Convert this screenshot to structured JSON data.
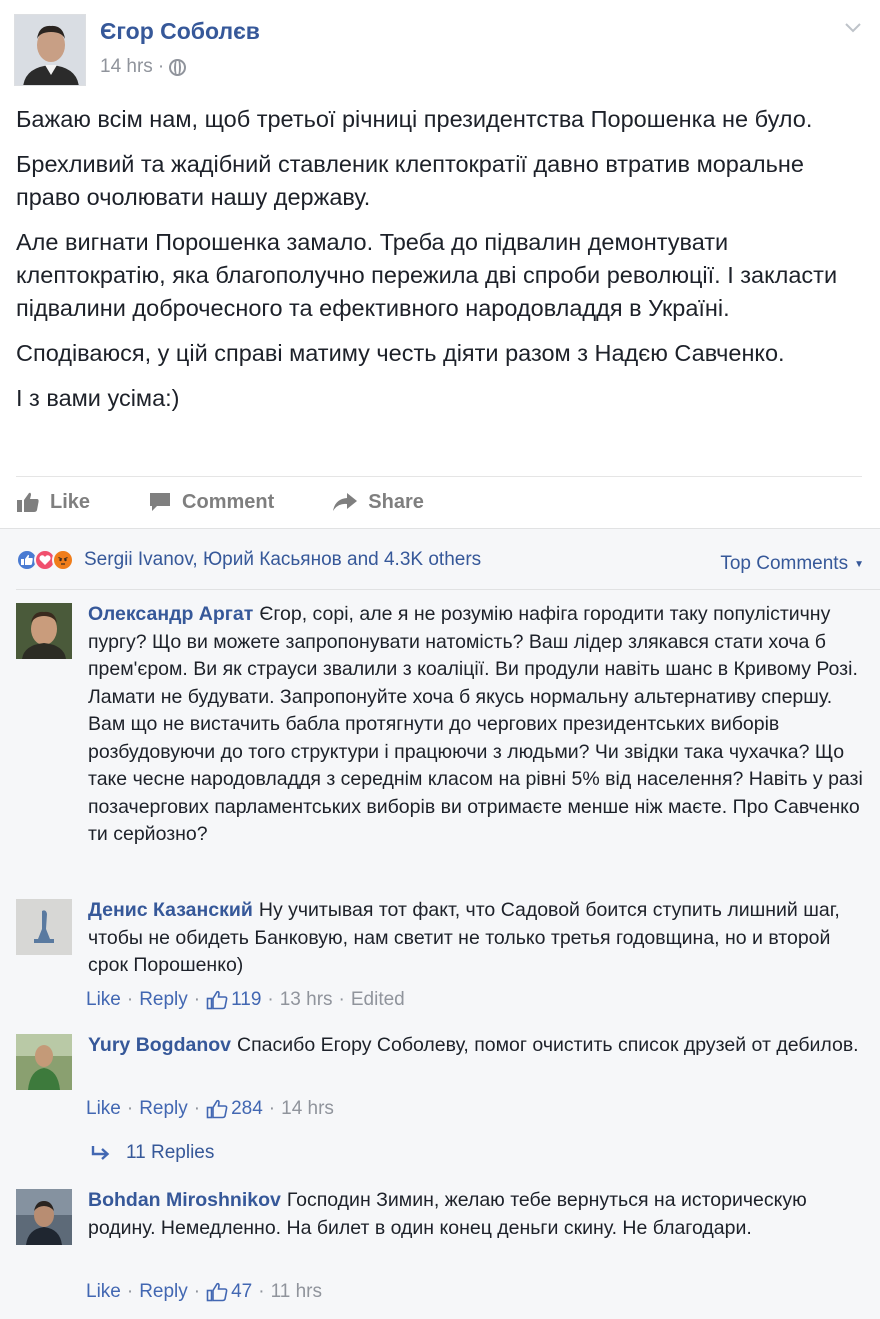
{
  "post": {
    "author": "Єгор Соболєв",
    "time": "14 hrs",
    "meta_separator": "·",
    "paragraphs": [
      "Бажаю всім нам, щоб третьої річниці президентства Порошенка не було.",
      "Брехливий та жадібний ставленик клептократії давно втратив моральне право очолювати нашу державу.",
      "Але вигнати Порошенка замало. Треба до підвалин демонтувати клептократію, яка благополучно пережила дві спроби революції. І закласти підвалини доброчесного та ефективного народовладдя в Україні.",
      "Сподіваюся, у цій справі матиму честь діяти разом з Надєю Савченко.",
      "І з вами усіма:)"
    ]
  },
  "actions": {
    "like": "Like",
    "comment": "Comment",
    "share": "Share"
  },
  "reactions": {
    "summary": "Sergii Ivanov, Юрий Касьянов and 4.3K others",
    "sort_label": "Top Comments"
  },
  "comments": [
    {
      "author": "Олександр Аргат",
      "text": "Єгор, сорі, але я не розумію нафіга городити таку популістичну пургу? Що ви можете запропонувати натомість? Ваш лідер злякався стати хоча б прем'єром. Ви як страуси звалили з коаліції. Ви продули навіть шанс в Кривому Розі. Ламати не будувати. Запропонуйте хоча б якусь нормальну альтернативу спершу. Вам що не вистачить бабла протягнути до чергових президентських виборів розбудовуючи до того структури і працюючи з людьми? Чи звідки така чухачка? Що таке чесне народовладдя з середнім класом на рівні 5% від населення? Навіть у разі позачергових парламентських виборів ви отримаєте менше ніж маєте. Про Савченко ти серйозно?"
    },
    {
      "author": "Денис Казанский",
      "text": "Ну учитывая тот факт, что Садовой боится ступить лишний шаг, чтобы не обидеть Банковую, нам светит не только третья годовщина, но и второй срок Порошенко)",
      "like": "Like",
      "reply": "Reply",
      "likes": "119",
      "time": "13 hrs",
      "edited": "Edited"
    },
    {
      "author": "Yury Bogdanov",
      "text": "Спасибо Егору Соболеву, помог очистить список друзей от дебилов.",
      "like": "Like",
      "reply": "Reply",
      "likes": "284",
      "time": "14 hrs",
      "replies": "11 Replies"
    },
    {
      "author": "Bohdan Miroshnikov",
      "text": "Господин Зимин, желаю тебе вернуться на историческую родину. Немедленно. На билет в один конец деньги скину. Не благодари.",
      "like": "Like",
      "reply": "Reply",
      "likes": "47",
      "time": "11 hrs"
    }
  ]
}
